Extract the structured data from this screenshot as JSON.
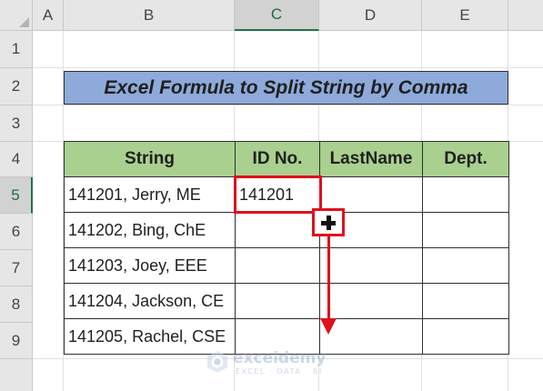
{
  "columns": [
    "A",
    "B",
    "C",
    "D",
    "E"
  ],
  "rows": [
    "1",
    "2",
    "3",
    "4",
    "5",
    "6",
    "7",
    "8",
    "9"
  ],
  "selected_column": "C",
  "selected_row": "5",
  "title": "Excel Formula to Split String by Comma",
  "table": {
    "headers": [
      "String",
      "ID No.",
      "LastName",
      "Dept."
    ],
    "rows": [
      [
        "141201, Jerry, ME",
        "141201",
        "",
        ""
      ],
      [
        "141202, Bing, ChE",
        "",
        "",
        ""
      ],
      [
        "141203, Joey, EEE",
        "",
        "",
        ""
      ],
      [
        "141204, Jackson, CE",
        "",
        "",
        ""
      ],
      [
        "141205, Rachel, CSE",
        "",
        "",
        ""
      ]
    ]
  },
  "annotations": {
    "highlight_cell": "C5",
    "fill_handle_icon": "plus-cursor-icon",
    "drag_direction": "down",
    "accent_color": "#e0101c"
  },
  "watermark": {
    "name": "exceldemy",
    "tagline": "EXCEL · DATA · BI"
  },
  "colors": {
    "title_fill": "#8eaadb",
    "header_fill": "#a9d08e",
    "selection_accent": "#217346"
  }
}
